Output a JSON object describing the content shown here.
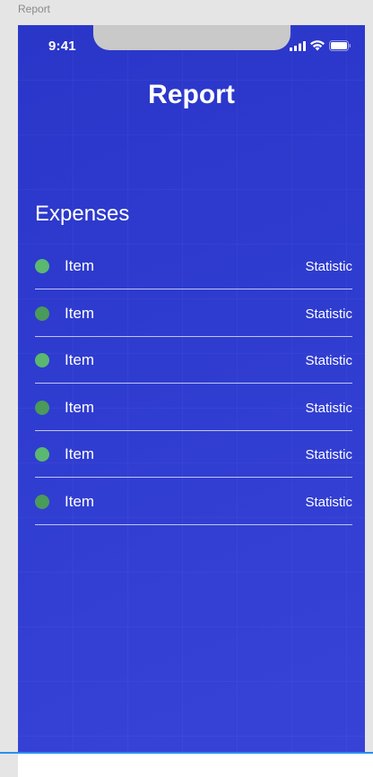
{
  "frame_label": "Report",
  "status_bar": {
    "time": "9:41",
    "icons": [
      "signal-icon",
      "wifi-icon",
      "battery-icon"
    ]
  },
  "header": {
    "title": "Report"
  },
  "expenses": {
    "title": "Expenses",
    "items": [
      {
        "label": "Item",
        "statistic": "Statistic",
        "dot_color": "#5bb870"
      },
      {
        "label": "Item",
        "statistic": "Statistic",
        "dot_color": "#4a9a5a"
      },
      {
        "label": "Item",
        "statistic": "Statistic",
        "dot_color": "#5bb870"
      },
      {
        "label": "Item",
        "statistic": "Statistic",
        "dot_color": "#4a9a5a"
      },
      {
        "label": "Item",
        "statistic": "Statistic",
        "dot_color": "#5bb870"
      },
      {
        "label": "Item",
        "statistic": "Statistic",
        "dot_color": "#4a9a5a"
      }
    ]
  },
  "colors": {
    "background": "#2f3cd0",
    "text": "#ffffff",
    "accent_border": "#2a8ef0"
  }
}
